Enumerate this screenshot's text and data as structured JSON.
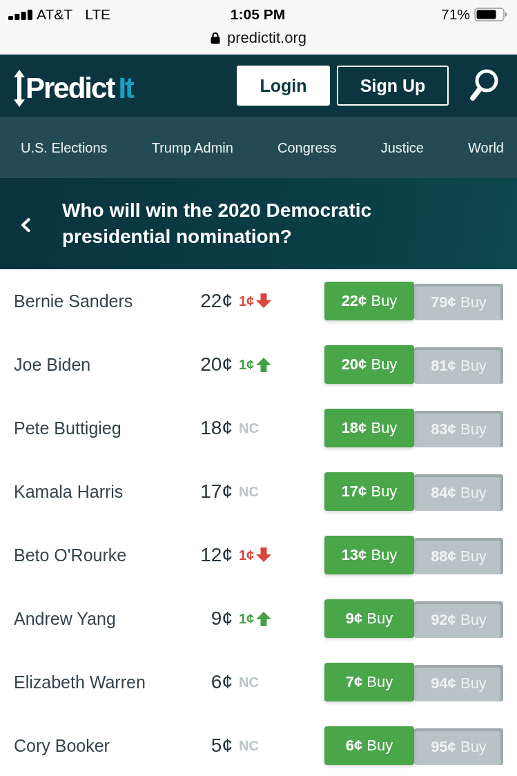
{
  "status_bar": {
    "carrier": "AT&T",
    "network": "LTE",
    "time": "1:05 PM",
    "battery": "71%",
    "url": "predictit.org"
  },
  "header": {
    "logo": {
      "part_1": "Predict",
      "part_2": "It"
    },
    "buttons": [
      {
        "label": "Login",
        "kind": "filled"
      },
      {
        "label": "Sign Up",
        "kind": "outline"
      }
    ]
  },
  "nav": {
    "items": [
      {
        "label": "U.S. Elections"
      },
      {
        "label": "Trump Admin"
      },
      {
        "label": "Congress"
      },
      {
        "label": "Justice"
      },
      {
        "label": "World"
      }
    ]
  },
  "market": {
    "title": "Who will win the 2020 Democratic presidential nomination?"
  },
  "contracts": [
    {
      "name": "Bernie Sanders",
      "price": "22¢",
      "change": {
        "text": "1¢",
        "kind": "down"
      },
      "yes_button": "**22¢** Buy",
      "no_button": "**79¢** Buy"
    },
    {
      "name": "Joe Biden",
      "price": "20¢",
      "change": {
        "text": "1¢",
        "kind": "up"
      },
      "yes_button": "**20¢** Buy",
      "no_button": "**81¢** Buy"
    },
    {
      "name": "Pete Buttigieg",
      "price": "18¢",
      "change": {
        "text": "NC",
        "kind": "flat"
      },
      "yes_button": "**18¢** Buy",
      "no_button": "**83¢** Buy"
    },
    {
      "name": "Kamala Harris",
      "price": "17¢",
      "change": {
        "text": "NC",
        "kind": "flat"
      },
      "yes_button": "**17¢** Buy",
      "no_button": "**84¢** Buy"
    },
    {
      "name": "Beto O'Rourke",
      "price": "12¢",
      "change": {
        "text": "1¢",
        "kind": "down"
      },
      "yes_button": "**13¢** Buy",
      "no_button": "**88¢** Buy"
    },
    {
      "name": "Andrew Yang",
      "price": "9¢",
      "change": {
        "text": "1¢",
        "kind": "up"
      },
      "yes_button": "**9¢** Buy",
      "no_button": "**92¢** Buy"
    },
    {
      "name": "Elizabeth Warren",
      "price": "6¢",
      "change": {
        "text": "NC",
        "kind": "flat"
      },
      "yes_button": "**7¢** Buy",
      "no_button": "**94¢** Buy"
    },
    {
      "name": "Cory Booker",
      "price": "5¢",
      "change": {
        "text": "NC",
        "kind": "flat"
      },
      "yes_button": "**6¢** Buy",
      "no_button": "**95¢** Buy"
    }
  ]
}
